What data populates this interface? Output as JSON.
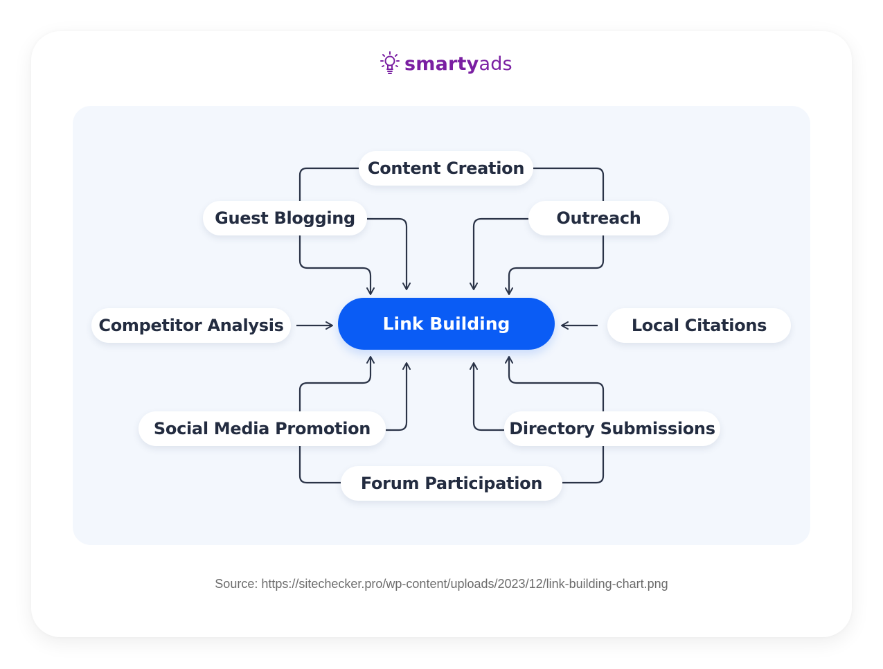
{
  "brand": {
    "name_bold": "smarty",
    "name_regular": "ads",
    "icon": "lightbulb-icon",
    "color": "#7a1fa2"
  },
  "diagram": {
    "center": {
      "label": "Link Building",
      "color": "#0a5cf5"
    },
    "nodes": [
      {
        "id": "content-creation",
        "label": "Content Creation"
      },
      {
        "id": "guest-blogging",
        "label": "Guest Blogging"
      },
      {
        "id": "outreach",
        "label": "Outreach"
      },
      {
        "id": "competitor-analysis",
        "label": "Competitor Analysis"
      },
      {
        "id": "local-citations",
        "label": "Local Citations"
      },
      {
        "id": "social-media-promotion",
        "label": "Social Media Promotion"
      },
      {
        "id": "directory-submissions",
        "label": "Directory Submissions"
      },
      {
        "id": "forum-participation",
        "label": "Forum Participation"
      }
    ],
    "edges": [
      {
        "from": "content-creation",
        "to": "center"
      },
      {
        "from": "guest-blogging",
        "to": "center"
      },
      {
        "from": "outreach",
        "to": "center"
      },
      {
        "from": "competitor-analysis",
        "to": "center"
      },
      {
        "from": "local-citations",
        "to": "center"
      },
      {
        "from": "social-media-promotion",
        "to": "center"
      },
      {
        "from": "directory-submissions",
        "to": "center"
      },
      {
        "from": "forum-participation",
        "to": "center"
      }
    ],
    "line_color": "#2a3347"
  },
  "footer": {
    "source": "Source: https://sitechecker.pro/wp-content/uploads/2023/12/link-building-chart.png"
  }
}
